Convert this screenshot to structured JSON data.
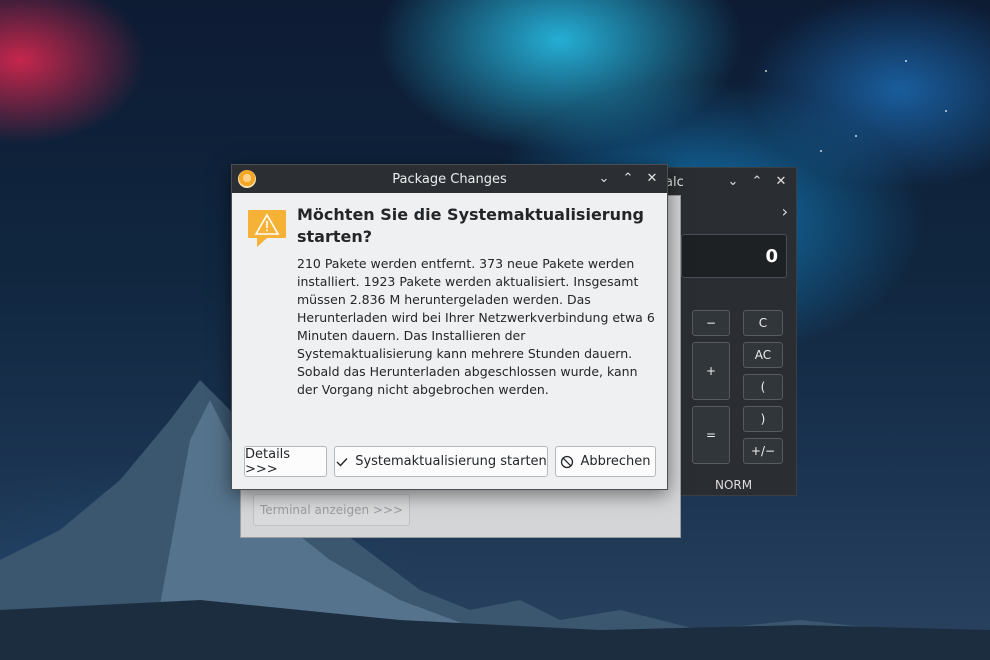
{
  "calculator": {
    "title": "alc",
    "display_value": "0",
    "toolbar_arrow": "›",
    "buttons": {
      "minus": "−",
      "clear": "C",
      "all_clear": "AC",
      "plus": "+",
      "open_paren": "(",
      "close_paren": ")",
      "equals": "=",
      "plus_minus": "+/−"
    },
    "mode": "NORM"
  },
  "updater": {
    "terminal_button": "Terminal anzeigen >>>"
  },
  "dialog": {
    "title": "Package Changes",
    "heading": "Möchten Sie die Systemaktualisierung starten?",
    "message": "210 Pakete werden entfernt. 373 neue Pakete werden installiert. 1923 Pakete werden aktualisiert. Insgesamt müssen 2.836 M heruntergeladen werden. Das Herunterladen wird bei Ihrer Netzwerkverbindung etwa 6 Minuten dauern. Das Installieren der Systemaktualisierung kann mehrere Stunden dauern. Sobald das Herunterladen abgeschlossen wurde, kann der Vorgang nicht abgebrochen werden.",
    "buttons": {
      "details": "Details >>>",
      "start": "Systemaktualisierung starten",
      "cancel": "Abbrechen"
    },
    "icons": {
      "app": "updater-app-icon",
      "warning": "warning-icon",
      "start": "checkmark-icon",
      "cancel": "cancel-circle-icon"
    },
    "colors": {
      "warning": "#f6b236",
      "titlebar": "#2b2f33"
    }
  }
}
